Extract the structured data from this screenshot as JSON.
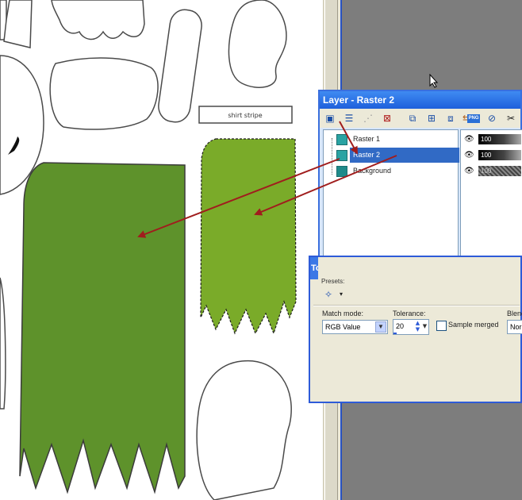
{
  "canvas": {
    "shirt_stripe_label": "shirt stripe",
    "colors": {
      "dark_green": "#5e922b",
      "light_green": "#7aab29",
      "outline": "#4a4a4a",
      "arrow": "#a01d1d"
    }
  },
  "layer_palette": {
    "title": "Layer - Raster 2",
    "toolbar_icons": [
      "new-raster-layer-icon",
      "new-layer-group-icon",
      "promote-layer-icon",
      "delete-layer-icon",
      "duplicate-layer-icon",
      "merge-layers-icon",
      "arrange-layers-icon",
      "link-layer-icon",
      "png-icon",
      "mask-icon",
      "cut-icon"
    ],
    "png_label": "PNG",
    "layers": [
      {
        "name": "Raster 1",
        "opacity": "100"
      },
      {
        "name": "Raster 2",
        "opacity": "100",
        "selected": true
      },
      {
        "name": "Background",
        "opacity": "100"
      }
    ]
  },
  "tool_options": {
    "title": "To",
    "presets_label": "Presets:",
    "match_mode_label": "Match mode:",
    "match_mode_value": "RGB Value",
    "tolerance_label": "Tolerance:",
    "tolerance_value": "20",
    "sample_merged_label": "Sample merged",
    "blend_label": "Blend",
    "blend_value": "Nor"
  }
}
